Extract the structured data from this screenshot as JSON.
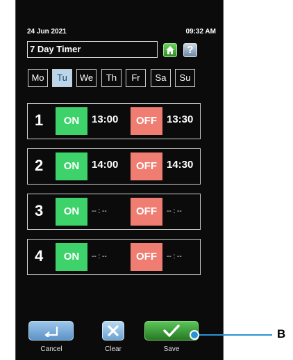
{
  "status": {
    "date": "24 Jun 2021",
    "time": "09:32 AM"
  },
  "title": "7 Day Timer",
  "help_glyph": "?",
  "icons": {
    "home": "home-icon",
    "help": "question-icon",
    "cancel": "undo-arrow-icon",
    "clear": "x-icon",
    "save": "checkmark-icon"
  },
  "days": [
    "Mo",
    "Tu",
    "We",
    "Th",
    "Fr",
    "Sa",
    "Su"
  ],
  "selected_day": "Tu",
  "slots": [
    {
      "num": "1",
      "on_label": "ON",
      "on_time": "13:00",
      "off_label": "OFF",
      "off_time": "13:30"
    },
    {
      "num": "2",
      "on_label": "ON",
      "on_time": "14:00",
      "off_label": "OFF",
      "off_time": "14:30"
    },
    {
      "num": "3",
      "on_label": "ON",
      "on_time": "-- : --",
      "off_label": "OFF",
      "off_time": "-- : --"
    },
    {
      "num": "4",
      "on_label": "ON",
      "on_time": "-- : --",
      "off_label": "OFF",
      "off_time": "-- : --"
    }
  ],
  "buttons": {
    "cancel": "Cancel",
    "clear": "Clear",
    "save": "Save"
  },
  "callout": "B",
  "colors": {
    "on": "#3ed26a",
    "off": "#f07d72",
    "active_day": "#b9d6ea",
    "callout": "#2a93d3"
  }
}
